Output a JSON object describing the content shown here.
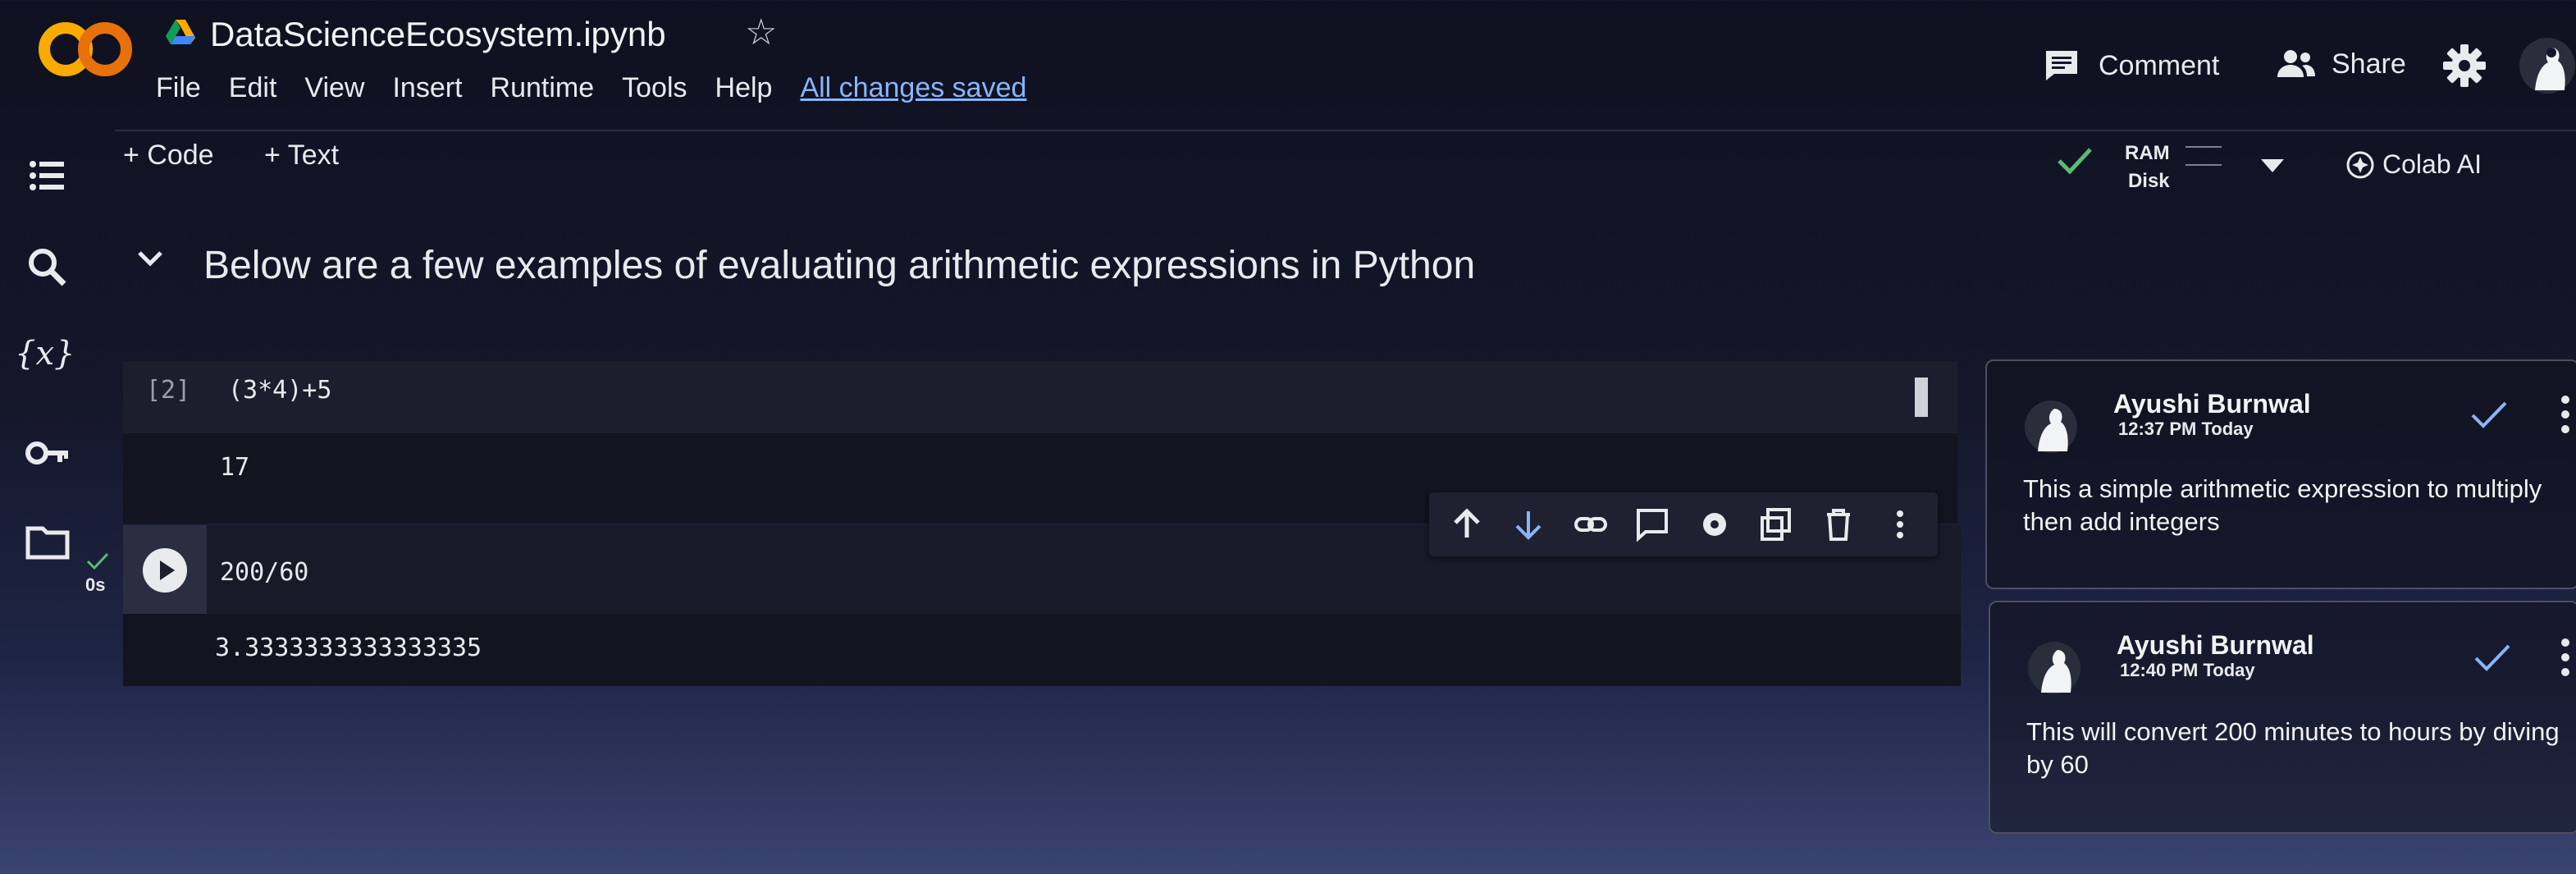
{
  "app": {
    "logo_text": "CO",
    "notebook_title": "DataScienceEcosystem.ipynb",
    "menu": [
      "File",
      "Edit",
      "View",
      "Insert",
      "Runtime",
      "Tools",
      "Help"
    ],
    "save_status": "All changes saved",
    "comment_label": "Comment",
    "share_label": "Share"
  },
  "toolbar": {
    "add_code": "+ Code",
    "add_text": "+ Text",
    "ram_label": "RAM",
    "disk_label": "Disk",
    "colab_ai_label": "Colab AI"
  },
  "sidebar": {
    "icons": [
      "table-of-contents-icon",
      "search-icon",
      "variables-icon",
      "key-icon",
      "folder-icon"
    ],
    "variables_glyph": "{x}"
  },
  "notebook": {
    "section_heading": "Below are a few examples of evaluating arithmetic expressions in Python",
    "cells": [
      {
        "exec_count": "[2]",
        "code": "(3*4)+5",
        "output": "17"
      },
      {
        "exec_time": "0s",
        "code": "200/60",
        "output": "3.3333333333333335"
      }
    ]
  },
  "comments": [
    {
      "author": "Ayushi Burnwal",
      "time": "12:37 PM Today",
      "body": "This a simple arithmetic expression to multiply then add integers"
    },
    {
      "author": "Ayushi Burnwal",
      "time": "12:40 PM Today",
      "body": "This will convert 200 minutes to hours by diving by 60"
    }
  ],
  "colors": {
    "accent_blue": "#8ab4f8",
    "logo_orange": "#f9ab00",
    "check_green": "#5bb974"
  }
}
